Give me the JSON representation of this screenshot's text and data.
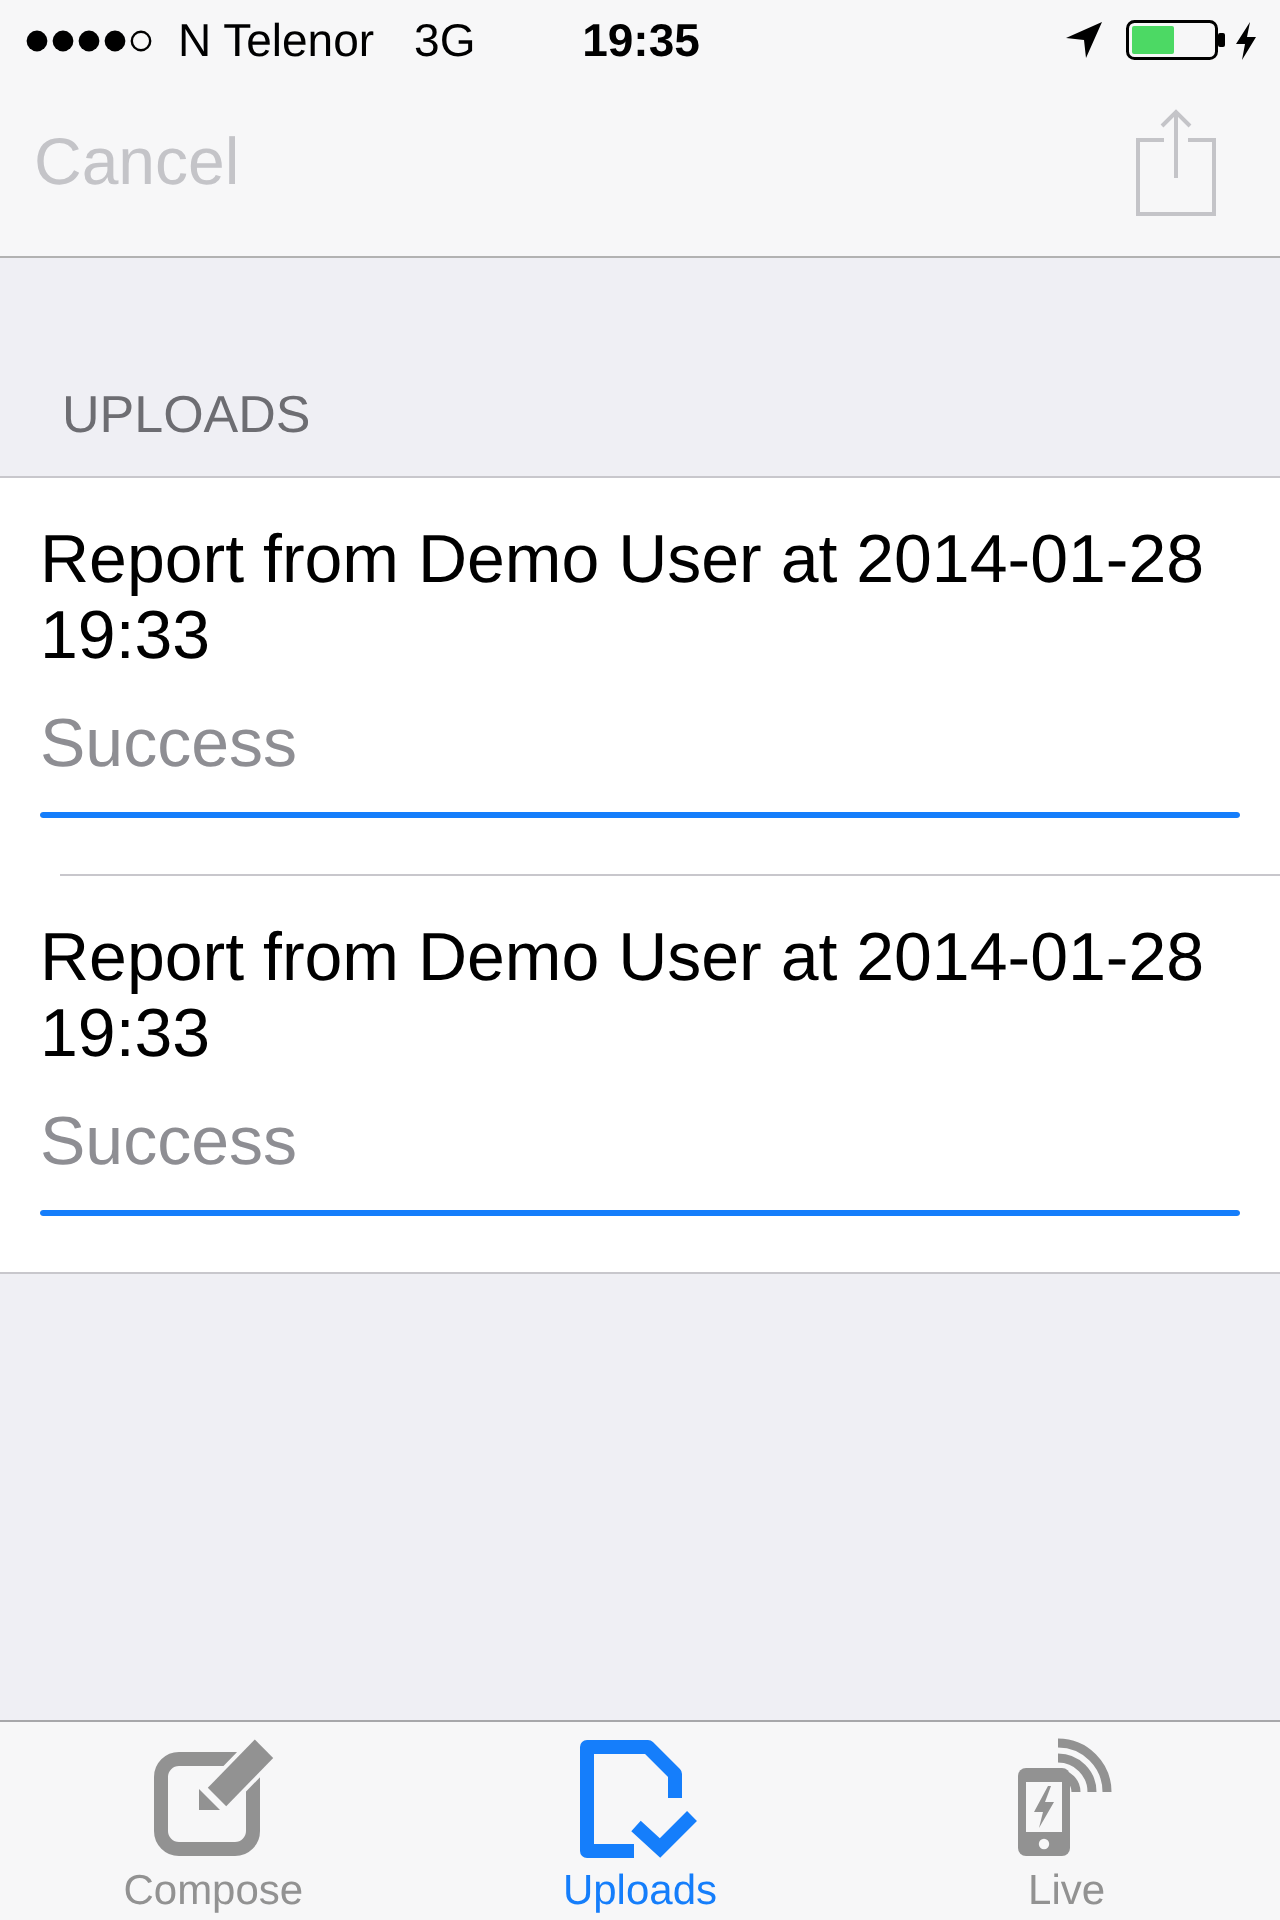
{
  "status_bar": {
    "carrier": "N Telenor",
    "network": "3G",
    "time": "19:35"
  },
  "nav_bar": {
    "cancel": {
      "label": "Cancel",
      "disabled": true
    },
    "share": {
      "disabled": true
    }
  },
  "section": {
    "header": "UPLOADS"
  },
  "uploads": [
    {
      "title": "Report from Demo User at 2014-01-28 19:33",
      "status": "Success",
      "level": 1
    },
    {
      "title": "Report from Demo User at 2014-01-28 19:33",
      "status": "Success",
      "level": 1
    }
  ],
  "tab_bar": {
    "tabs": [
      {
        "kind": "compose",
        "label": "Compose",
        "selected": false
      },
      {
        "kind": "uploads",
        "label": "Uploads",
        "selected": true
      },
      {
        "kind": "live",
        "label": "Live",
        "selected": false
      }
    ]
  }
}
